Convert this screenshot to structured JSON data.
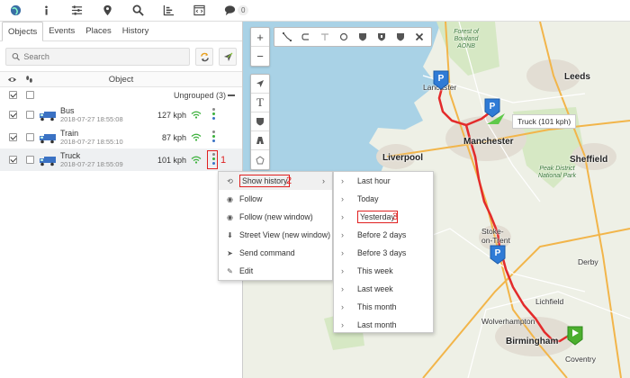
{
  "topbar": {
    "icons": [
      "globe-icon",
      "info-icon",
      "sliders-icon",
      "map-marker-icon",
      "search-icon",
      "chart-icon",
      "code-window-icon",
      "chat-icon"
    ],
    "chat_count": "0"
  },
  "left": {
    "tabs": [
      "Objects",
      "Events",
      "Places",
      "History"
    ],
    "active_tab": "Objects",
    "search_placeholder": "Search",
    "table_header": "Object",
    "group_label": "Ungrouped (3)",
    "objects": [
      {
        "name": "Bus",
        "time": "2018-07-27 18:55:08",
        "speed": "127 kph"
      },
      {
        "name": "Train",
        "time": "2018-07-27 18:55:10",
        "speed": "87 kph"
      },
      {
        "name": "Truck",
        "time": "2018-07-27 18:55:09",
        "speed": "101 kph"
      }
    ]
  },
  "annotations": {
    "one": "1",
    "two": "2",
    "three": "3"
  },
  "context_menu": {
    "items": [
      "Show history",
      "Follow",
      "Follow (new window)",
      "Street View (new window)",
      "Send command",
      "Edit"
    ]
  },
  "history_submenu": {
    "items": [
      "Last hour",
      "Today",
      "Yesterday",
      "Before 2 days",
      "Before 3 days",
      "This week",
      "Last week",
      "This month",
      "Last month"
    ]
  },
  "map": {
    "places": {
      "lancaster": "Lancaster",
      "forest": "Forest of Bowland AONB",
      "leeds": "Leeds",
      "liverpool": "Liverpool",
      "manchester": "Manchester",
      "sheffield": "Sheffield",
      "peak": "Peak District National Park",
      "stoke": "Stoke-on-Trent",
      "derby": "Derby",
      "lichfield": "Lichfield",
      "wolverhampton": "Wolverhampton",
      "birmingham": "Birmingham",
      "coventry": "Coventry"
    },
    "truck_tooltip": "Truck (101 kph)",
    "pin_label": "P",
    "route_color": "#e32b2b"
  }
}
